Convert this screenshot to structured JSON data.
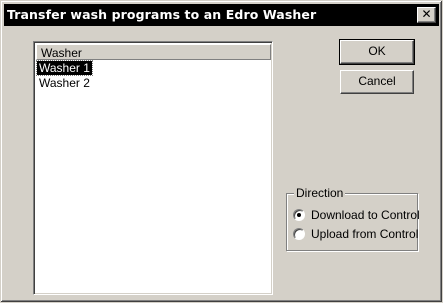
{
  "window": {
    "title": "Transfer wash programs to an Edro Washer",
    "close_glyph": "✕"
  },
  "list": {
    "header": "Washer",
    "items": [
      "Washer 1",
      "Washer 2"
    ],
    "selected_index": 0
  },
  "buttons": {
    "ok": "OK",
    "cancel": "Cancel"
  },
  "direction": {
    "label": "Direction",
    "options": [
      "Download to Control",
      "Upload from Control"
    ],
    "selected_index": 0
  }
}
